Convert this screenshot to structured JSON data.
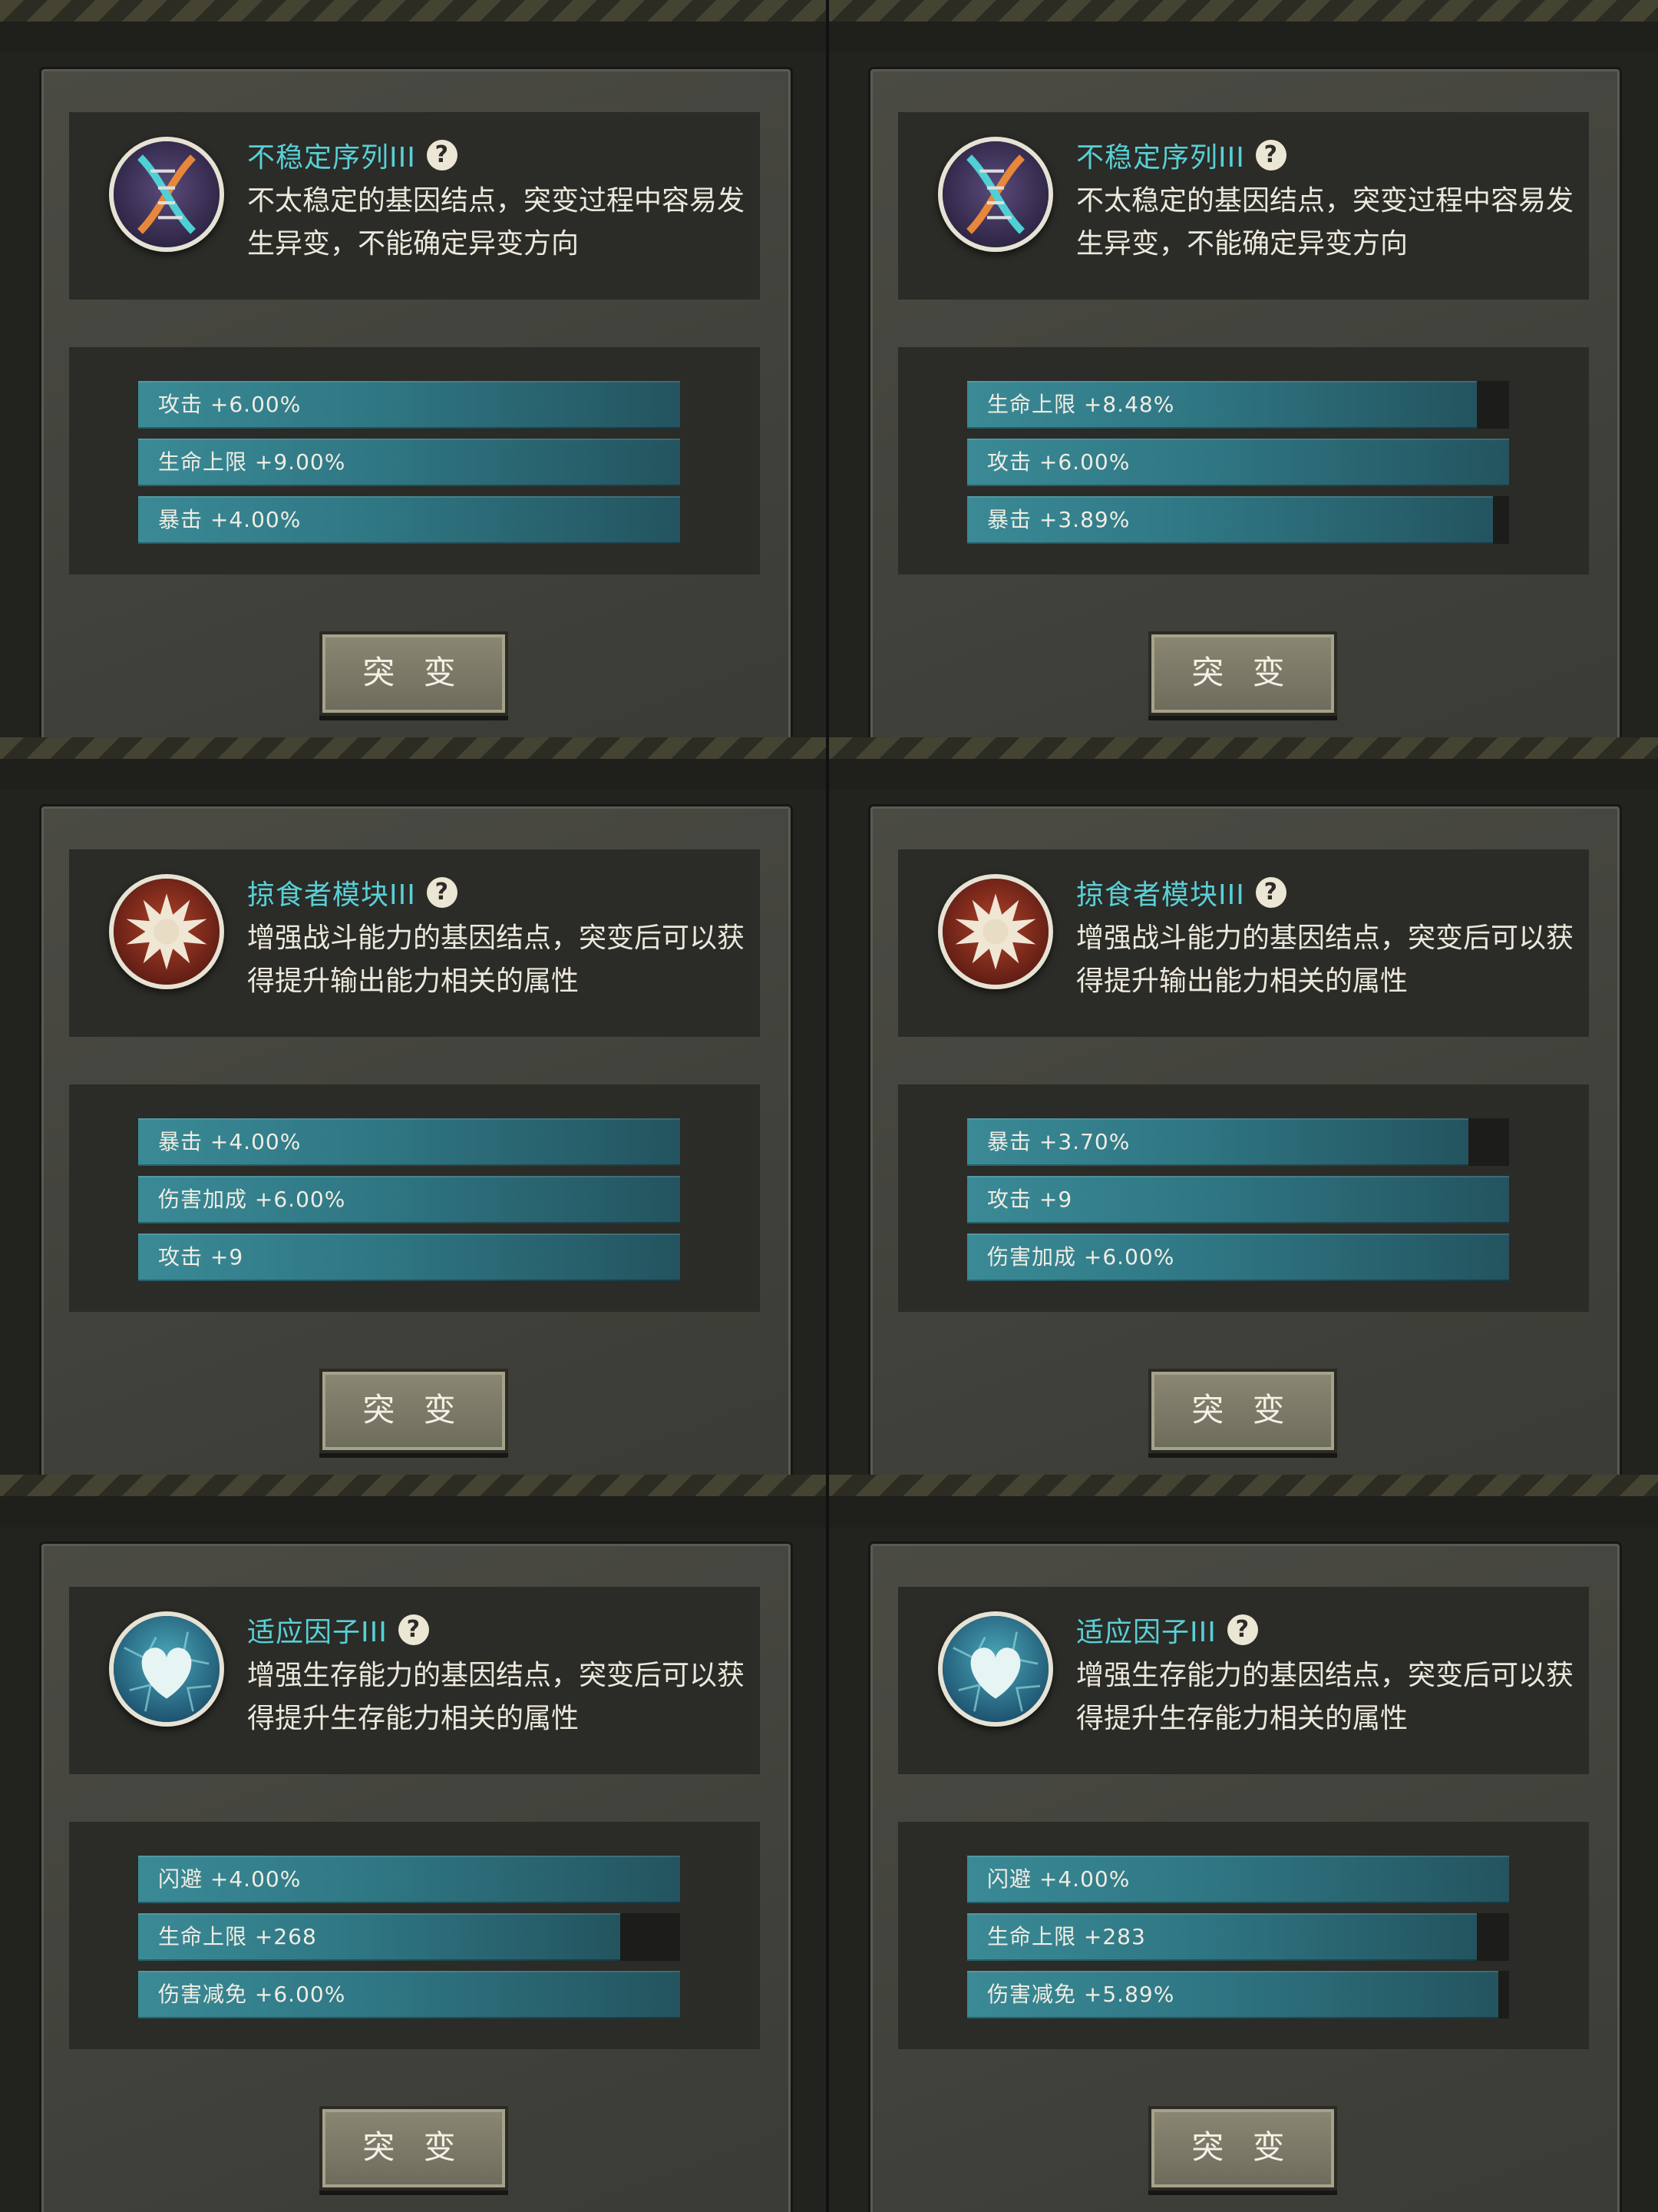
{
  "mutate_label": "突 变",
  "help_glyph": "?",
  "colors": {
    "title": "#58d0d6",
    "bar_fill": "#2f7683"
  },
  "cells": [
    {
      "title": "不稳定序列III",
      "icon": "dna-icon",
      "desc": "不太稳定的基因结点，突变过程中容易发生异变，不能确定异变方向",
      "stats": [
        {
          "label": "攻击 +6.00%",
          "fill": 1.0
        },
        {
          "label": "生命上限 +9.00%",
          "fill": 1.0
        },
        {
          "label": "暴击 +4.00%",
          "fill": 1.0
        }
      ]
    },
    {
      "title": "不稳定序列III",
      "icon": "dna-icon",
      "desc": "不太稳定的基因结点，突变过程中容易发生异变，不能确定异变方向",
      "stats": [
        {
          "label": "生命上限 +8.48%",
          "fill": 0.94
        },
        {
          "label": "攻击 +6.00%",
          "fill": 1.0
        },
        {
          "label": "暴击 +3.89%",
          "fill": 0.97
        }
      ]
    },
    {
      "title": "掠食者模块III",
      "icon": "predator-burst-icon",
      "desc": "增强战斗能力的基因结点，突变后可以获得提升输出能力相关的属性",
      "stats": [
        {
          "label": "暴击 +4.00%",
          "fill": 1.0
        },
        {
          "label": "伤害加成 +6.00%",
          "fill": 1.0
        },
        {
          "label": "攻击 +9",
          "fill": 1.0
        }
      ]
    },
    {
      "title": "掠食者模块III",
      "icon": "predator-burst-icon",
      "desc": "增强战斗能力的基因结点，突变后可以获得提升输出能力相关的属性",
      "stats": [
        {
          "label": "暴击 +3.70%",
          "fill": 0.925
        },
        {
          "label": "攻击 +9",
          "fill": 1.0
        },
        {
          "label": "伤害加成 +6.00%",
          "fill": 1.0
        }
      ]
    },
    {
      "title": "适应因子III",
      "icon": "heart-shield-icon",
      "desc": "增强生存能力的基因结点，突变后可以获得提升生存能力相关的属性",
      "stats": [
        {
          "label": "闪避 +4.00%",
          "fill": 1.0
        },
        {
          "label": "生命上限 +268",
          "fill": 0.89
        },
        {
          "label": "伤害减免 +6.00%",
          "fill": 1.0
        }
      ]
    },
    {
      "title": "适应因子III",
      "icon": "heart-shield-icon",
      "desc": "增强生存能力的基因结点，突变后可以获得提升生存能力相关的属性",
      "stats": [
        {
          "label": "闪避 +4.00%",
          "fill": 1.0
        },
        {
          "label": "生命上限 +283",
          "fill": 0.94
        },
        {
          "label": "伤害减免 +5.89%",
          "fill": 0.98
        }
      ]
    }
  ]
}
